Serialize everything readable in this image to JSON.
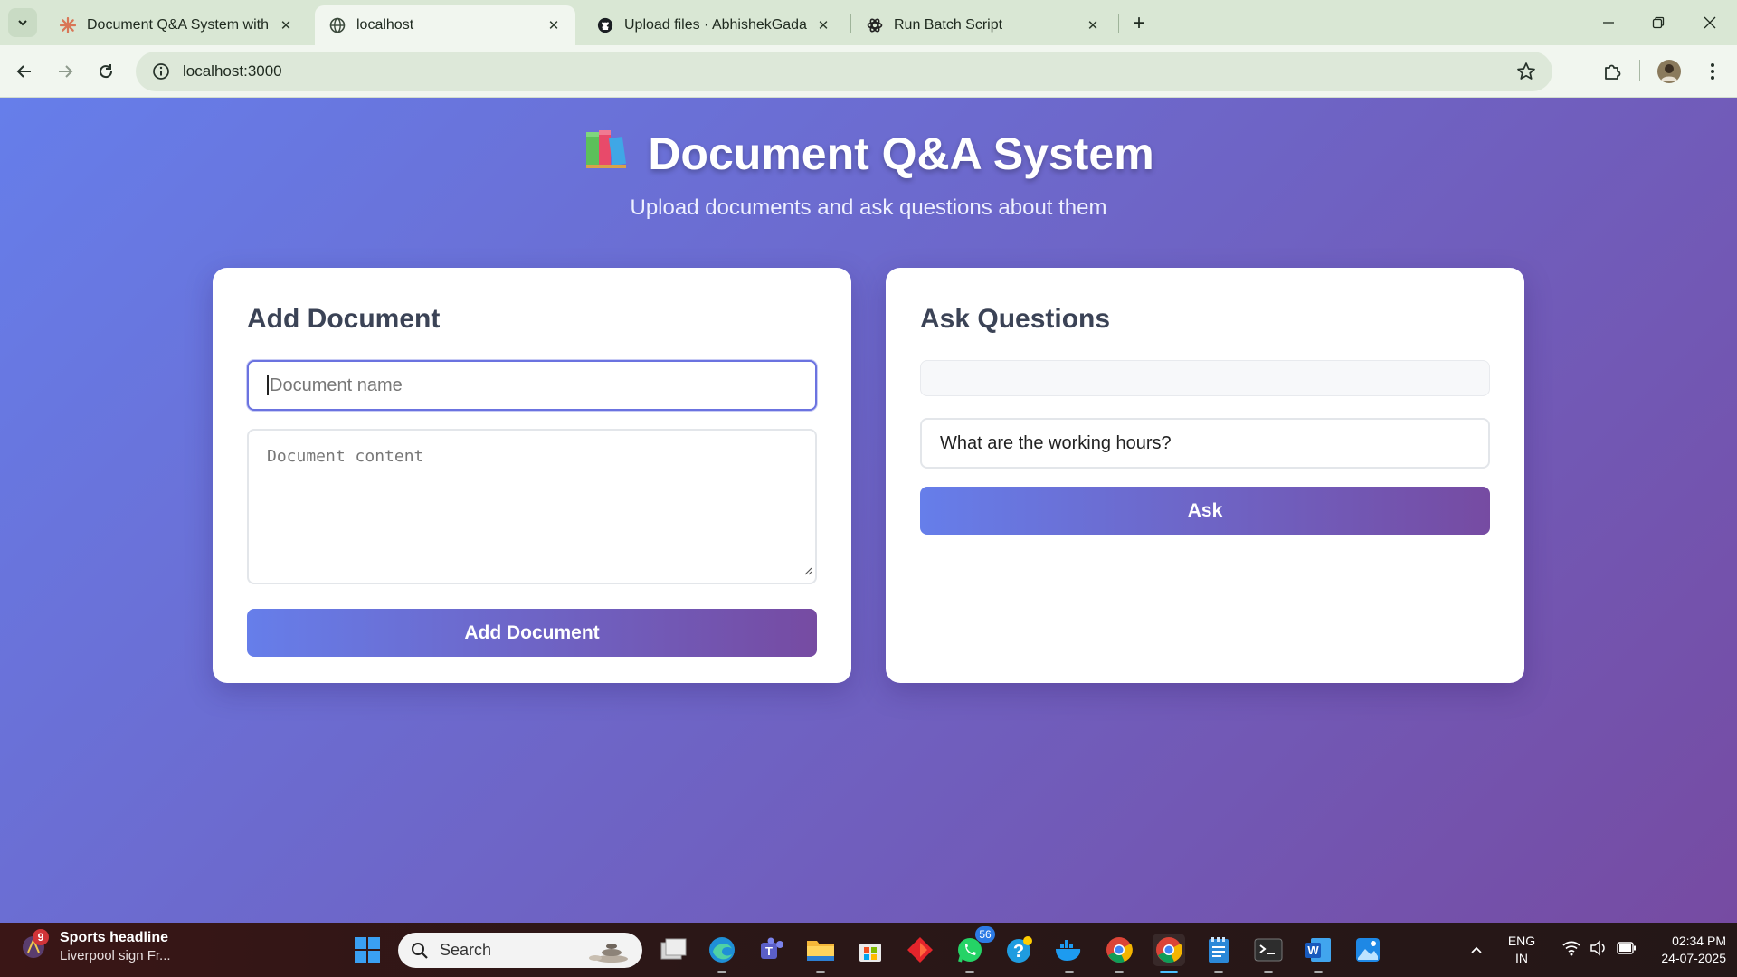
{
  "browser": {
    "tabs": [
      {
        "title": "Document Q&A System with Q",
        "active": false
      },
      {
        "title": "localhost",
        "active": true
      },
      {
        "title": "Upload files · AbhishekGadagin",
        "active": false
      },
      {
        "title": "Run Batch Script",
        "active": false
      }
    ],
    "url": "localhost:3000"
  },
  "page": {
    "emoji": "📚",
    "title": "Document Q&A System",
    "subtitle": "Upload documents and ask questions about them",
    "add_card": {
      "heading": "Add Document",
      "name_placeholder": "Document name",
      "content_placeholder": "Document content",
      "button": "Add Document"
    },
    "ask_card": {
      "heading": "Ask Questions",
      "select_value": "",
      "question_value": "What are the working hours?",
      "button": "Ask"
    }
  },
  "taskbar": {
    "news_badge": "9",
    "news_title": "Sports headline",
    "news_subtitle": "Liverpool sign Fr...",
    "search_label": "Search",
    "whatsapp_badge": "56",
    "lang_line1": "ENG",
    "lang_line2": "IN",
    "time": "02:34 PM",
    "date": "24-07-2025"
  },
  "colors": {
    "gradient_start": "#667eea",
    "gradient_end": "#764ba2",
    "heading_text": "#3b4356"
  }
}
